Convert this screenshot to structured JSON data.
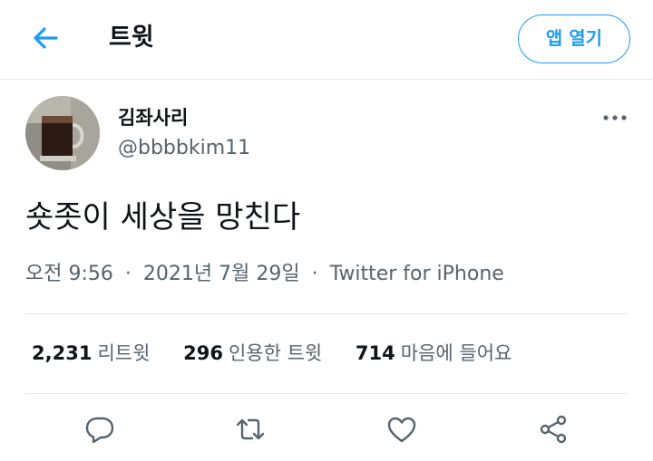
{
  "header": {
    "title": "트윗",
    "open_app_label": "앱 열기"
  },
  "tweet": {
    "author_name": "김좌사리",
    "author_handle": "@bbbbkim11",
    "text": "숏좃이 세상을 망친다",
    "time": "오전 9:56",
    "separator": "·",
    "date": "2021년 7월 29일",
    "source": "Twitter for iPhone"
  },
  "stats": [
    {
      "count": "2,231",
      "label": "리트윗"
    },
    {
      "count": "296",
      "label": "인용한 트윗"
    },
    {
      "count": "714",
      "label": "마음에 들어요"
    }
  ],
  "colors": {
    "accent": "#1d9bf0",
    "text": "#0f1419",
    "secondary": "#56636e",
    "divider": "#e3e9ed"
  },
  "icons": [
    "back-arrow-icon",
    "more-icon",
    "reply-icon",
    "retweet-icon",
    "like-icon",
    "share-icon"
  ]
}
